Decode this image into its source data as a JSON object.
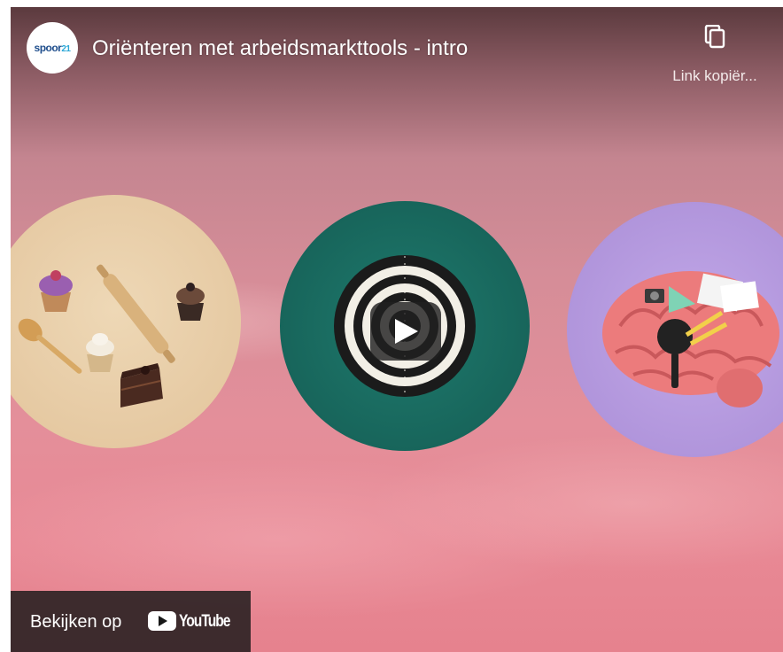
{
  "video": {
    "title": "Oriënteren met arbeidsmarkttools - intro",
    "channel_logo_text": "spoor21"
  },
  "share": {
    "label": "Link kopiër...",
    "icon": "copy-icon"
  },
  "player": {
    "play_icon": "play-icon",
    "watch_on_label": "Bekijken op",
    "youtube_wordmark": "YouTube"
  },
  "colors": {
    "background_pink": "#e48f9a",
    "circle_left": "#e8cea8",
    "circle_mid": "#1a6b60",
    "circle_right": "#b89ce0",
    "youtube_red": "#ff0000"
  }
}
